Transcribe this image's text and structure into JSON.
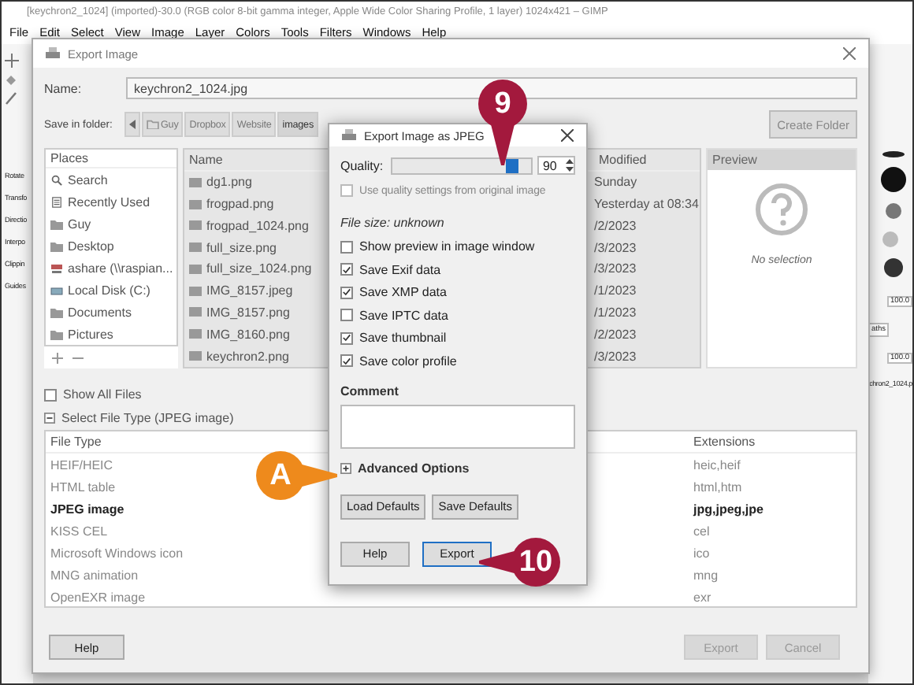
{
  "gimp_window": {
    "title": "[keychron2_1024] (imported)-30.0 (RGB color 8-bit gamma integer, Apple Wide Color Sharing Profile, 1 layer) 1024x421 – GIMP",
    "menu": [
      "File",
      "Edit",
      "Select",
      "View",
      "Image",
      "Layer",
      "Colors",
      "Tools",
      "Filters",
      "Windows",
      "Help"
    ],
    "tool_options": [
      "Rotate",
      "Transfo",
      "Directio",
      "Interpo",
      "Clippin",
      "Guides"
    ],
    "dock_values": [
      "100.0",
      "100.0"
    ],
    "dock_tab": "aths",
    "layer_name": "chron2_1024.p"
  },
  "export_dialog": {
    "title": "Export Image",
    "name_label": "Name:",
    "name_value": "keychron2_1024.jpg",
    "folder_label": "Save in folder:",
    "folder_path": [
      {
        "label": "Guy",
        "selected": false
      },
      {
        "label": "Dropbox",
        "selected": false
      },
      {
        "label": "Website",
        "selected": false
      },
      {
        "label": "images",
        "selected": true
      }
    ],
    "create_folder": "Create Folder",
    "places_header": "Places",
    "places": [
      {
        "label": "Search",
        "kind": "search"
      },
      {
        "label": "Recently Used",
        "kind": "recent"
      },
      {
        "label": "Guy",
        "kind": "folder"
      },
      {
        "label": "Desktop",
        "kind": "folder"
      },
      {
        "label": "ashare (\\\\raspian...",
        "kind": "network"
      },
      {
        "label": "Local Disk (C:)",
        "kind": "drive"
      },
      {
        "label": "Documents",
        "kind": "folder"
      },
      {
        "label": "Pictures",
        "kind": "folder"
      }
    ],
    "files_header": "Name",
    "modified_header": "Modified",
    "files": [
      {
        "name": "dg1.png",
        "modified": "Sunday"
      },
      {
        "name": "frogpad.png",
        "modified": "Yesterday at 08:34"
      },
      {
        "name": "frogpad_1024.png",
        "modified": "/2/2023"
      },
      {
        "name": "full_size.png",
        "modified": "/3/2023"
      },
      {
        "name": "full_size_1024.png",
        "modified": "/3/2023"
      },
      {
        "name": "IMG_8157.jpeg",
        "modified": "/1/2023"
      },
      {
        "name": "IMG_8157.png",
        "modified": "/1/2023"
      },
      {
        "name": "IMG_8160.png",
        "modified": "/2/2023"
      },
      {
        "name": "keychron2.png",
        "modified": "/3/2023"
      }
    ],
    "preview": {
      "header": "Preview",
      "message": "No selection"
    },
    "show_all_files": {
      "label": "Show All Files",
      "checked": false
    },
    "file_type_expander": {
      "label": "Select File Type (JPEG image)",
      "expanded": true
    },
    "file_type_columns": [
      "File Type",
      "Extensions"
    ],
    "file_types": [
      {
        "name": "HEIF/HEIC",
        "extensions": "heic,heif",
        "selected": false
      },
      {
        "name": "HTML table",
        "extensions": "html,htm",
        "selected": false
      },
      {
        "name": "JPEG image",
        "extensions": "jpg,jpeg,jpe",
        "selected": true
      },
      {
        "name": "KISS CEL",
        "extensions": "cel",
        "selected": false
      },
      {
        "name": "Microsoft Windows icon",
        "extensions": "ico",
        "selected": false
      },
      {
        "name": "MNG animation",
        "extensions": "mng",
        "selected": false
      },
      {
        "name": "OpenEXR image",
        "extensions": "exr",
        "selected": false
      }
    ],
    "buttons": [
      {
        "label": "Help",
        "disabled": false
      },
      {
        "label": "Export",
        "disabled": true
      },
      {
        "label": "Cancel",
        "disabled": true
      }
    ]
  },
  "jpeg_dialog": {
    "title": "Export Image as JPEG",
    "quality_label": "Quality:",
    "quality": {
      "level": 0.9,
      "value": "90"
    },
    "use_original": {
      "label": "Use quality settings from original image",
      "checked": false,
      "disabled": true
    },
    "file_size": "File size: unknown",
    "options": [
      {
        "label": "Show preview in image window",
        "checked": false
      },
      {
        "label": "Save Exif data",
        "checked": true
      },
      {
        "label": "Save XMP data",
        "checked": true
      },
      {
        "label": "Save IPTC data",
        "checked": false
      },
      {
        "label": "Save thumbnail",
        "checked": true
      },
      {
        "label": "Save color profile",
        "checked": true
      }
    ],
    "comment_label": "Comment",
    "advanced": {
      "label": "Advanced Options",
      "expanded": false
    },
    "default_buttons": [
      "Load Defaults",
      "Save Defaults"
    ],
    "buttons": [
      {
        "label": "Help",
        "focused": false
      },
      {
        "label": "Export",
        "focused": true
      }
    ]
  },
  "callouts": [
    {
      "label": "9",
      "kind": "down",
      "color": "#a3193d"
    },
    {
      "label": "10",
      "kind": "left",
      "color": "#a3193d"
    },
    {
      "label": "A",
      "kind": "right",
      "color": "#ee8a1c"
    }
  ]
}
